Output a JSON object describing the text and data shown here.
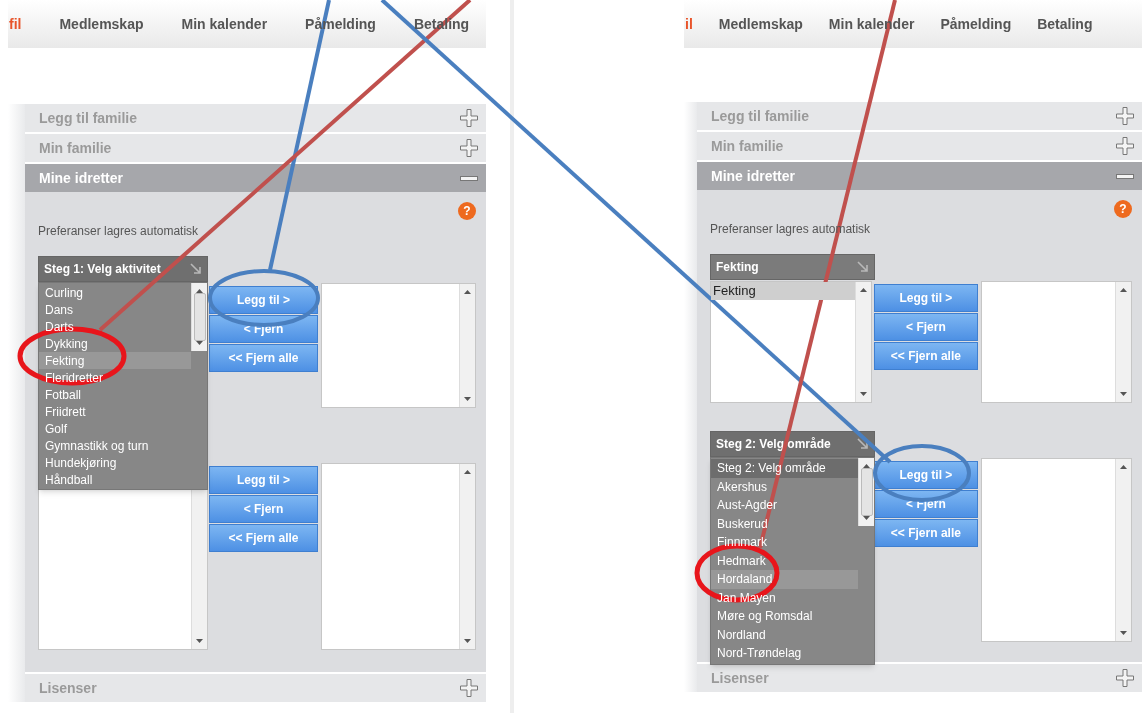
{
  "panels": [
    {
      "nav": [
        {
          "label": "fil",
          "active": true
        },
        {
          "label": "Medlemskap",
          "active": false
        },
        {
          "label": "Min kalender",
          "active": false
        },
        {
          "label": "Påmelding",
          "active": false
        },
        {
          "label": "Betaling",
          "active": false
        }
      ],
      "sections": [
        {
          "title": "Legg til familie",
          "expanded": false
        },
        {
          "title": "Min familie",
          "expanded": false
        },
        {
          "title": "Mine idretter",
          "expanded": true
        },
        {
          "title": "Lisenser",
          "expanded": false
        }
      ],
      "help": "?",
      "note": "Preferanser lagres automatisk",
      "groups": [
        {
          "dropdown": {
            "label": "Steg 1: Velg aktivitet",
            "open": true,
            "options": [
              {
                "label": "Curling",
                "selected": false,
                "highlighted": false
              },
              {
                "label": "Dans",
                "selected": false,
                "highlighted": false
              },
              {
                "label": "Darts",
                "selected": false,
                "highlighted": false
              },
              {
                "label": "Dykking",
                "selected": false,
                "highlighted": false
              },
              {
                "label": "Fekting",
                "selected": false,
                "highlighted": true
              },
              {
                "label": "Fleridretter",
                "selected": false,
                "highlighted": false
              },
              {
                "label": "Fotball",
                "selected": false,
                "highlighted": false
              },
              {
                "label": "Friidrett",
                "selected": false,
                "highlighted": false
              },
              {
                "label": "Golf",
                "selected": false,
                "highlighted": false
              },
              {
                "label": "Gymnastikk og turn",
                "selected": false,
                "highlighted": false
              },
              {
                "label": "Hundekjøring",
                "selected": false,
                "highlighted": false
              },
              {
                "label": "Håndball",
                "selected": false,
                "highlighted": false
              }
            ]
          },
          "buttons": [
            "Legg til >",
            "< Fjern",
            "<< Fjern alle"
          ]
        },
        {
          "buttons": [
            "Legg til >",
            "< Fjern",
            "<< Fjern alle"
          ]
        }
      ]
    },
    {
      "nav": [
        {
          "label": "il",
          "active": true
        },
        {
          "label": "Medlemskap",
          "active": false
        },
        {
          "label": "Min kalender",
          "active": false
        },
        {
          "label": "Påmelding",
          "active": false
        },
        {
          "label": "Betaling",
          "active": false
        }
      ],
      "sections": [
        {
          "title": "Legg til familie",
          "expanded": false
        },
        {
          "title": "Min familie",
          "expanded": false
        },
        {
          "title": "Mine idretter",
          "expanded": true
        },
        {
          "title": "Lisenser",
          "expanded": false
        }
      ],
      "help": "?",
      "note": "Preferanser lagres automatisk",
      "groups": [
        {
          "dropdown": {
            "label": "Fekting",
            "open": false
          },
          "available": [
            {
              "label": "Fekting",
              "selected": true
            }
          ],
          "buttons": [
            "Legg til >",
            "< Fjern",
            "<< Fjern alle"
          ]
        },
        {
          "dropdown": {
            "label": "Steg 2: Velg område",
            "open": true,
            "options": [
              {
                "label": "Steg 2: Velg område",
                "selected": true,
                "highlighted": false
              },
              {
                "label": "Akershus",
                "selected": false,
                "highlighted": false
              },
              {
                "label": "Aust-Agder",
                "selected": false,
                "highlighted": false
              },
              {
                "label": "Buskerud",
                "selected": false,
                "highlighted": false
              },
              {
                "label": "Finnmark",
                "selected": false,
                "highlighted": false
              },
              {
                "label": "Hedmark",
                "selected": false,
                "highlighted": false
              },
              {
                "label": "Hordaland",
                "selected": false,
                "highlighted": true
              },
              {
                "label": "Jan Mayen",
                "selected": false,
                "highlighted": false
              },
              {
                "label": "Møre og Romsdal",
                "selected": false,
                "highlighted": false
              },
              {
                "label": "Nordland",
                "selected": false,
                "highlighted": false
              },
              {
                "label": "Nord-Trøndelag",
                "selected": false,
                "highlighted": false
              }
            ]
          },
          "buttons": [
            "Legg til >",
            "< Fjern",
            "<< Fjern alle"
          ]
        }
      ]
    }
  ]
}
